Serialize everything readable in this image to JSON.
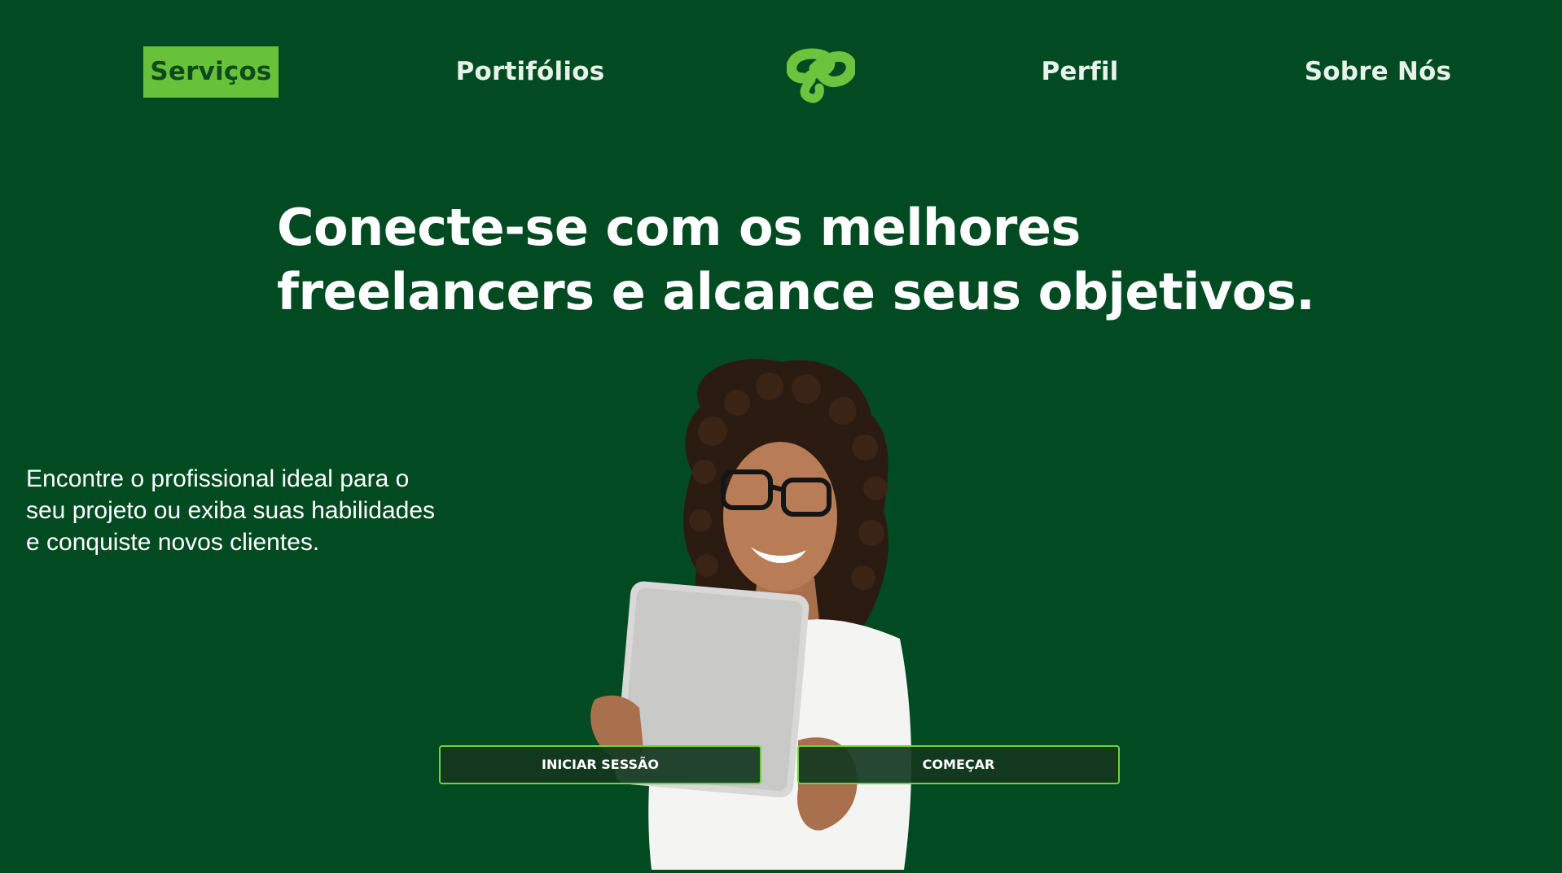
{
  "nav": {
    "items": [
      {
        "label": "Serviços",
        "active": true
      },
      {
        "label": "Portifólios",
        "active": false
      },
      {
        "label": "Perfil",
        "active": false
      },
      {
        "label": "Sobre Nós",
        "active": false
      }
    ],
    "logo_icon": "link-loop-logo-icon"
  },
  "hero": {
    "headline_line1": "Conecte-se com os melhores",
    "headline_line2": "freelancers e alcance seus objetivos.",
    "subtext": "Encontre o profissional ideal para o seu projeto ou exiba suas habilidades e conquiste novos clientes.",
    "image": "woman-with-tablet-photo"
  },
  "buttons": {
    "login_label": "INICIAR SESSÃO",
    "start_label": "COMEÇAR"
  },
  "colors": {
    "background": "#024b22",
    "accent": "#67c23a",
    "button_border": "#6dd23e"
  }
}
